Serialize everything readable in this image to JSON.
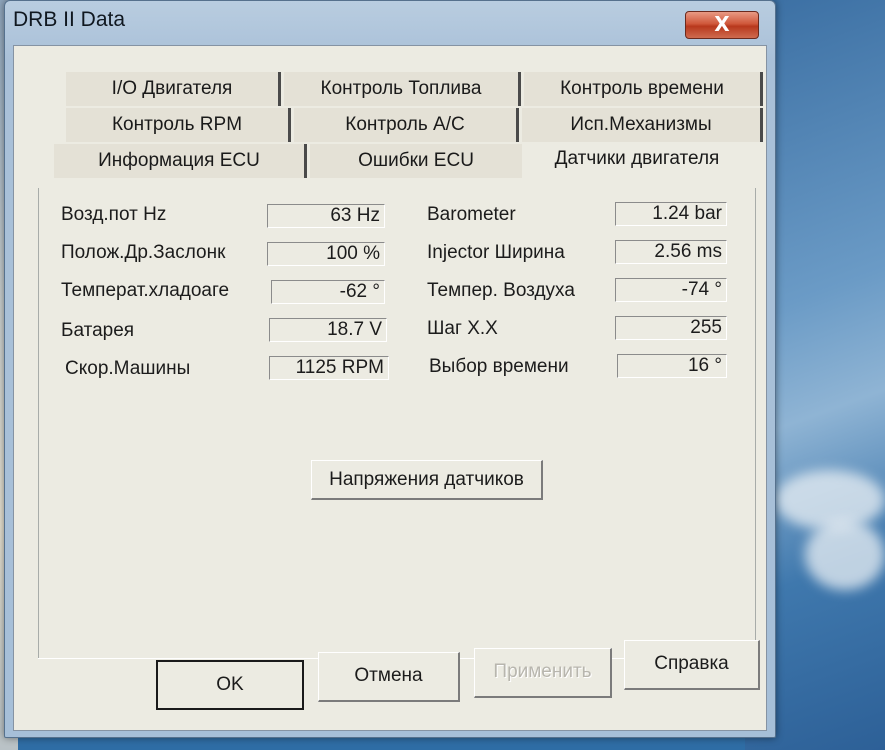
{
  "window": {
    "title": "DRB II Data",
    "close_glyph": "X"
  },
  "tabs": [
    {
      "label": "I/O Двигателя"
    },
    {
      "label": "Контроль Топлива"
    },
    {
      "label": "Контроль времени"
    },
    {
      "label": "Контроль RPM"
    },
    {
      "label": "Контроль A/C"
    },
    {
      "label": "Исп.Механизмы"
    },
    {
      "label": "Информация ECU"
    },
    {
      "label": "Ошибки ECU"
    },
    {
      "label": "Датчики двигателя",
      "active": true
    }
  ],
  "sensors_left": [
    {
      "label": "Возд.пот Hz",
      "value": "63 Hz"
    },
    {
      "label": "Полож.Др.Заслонк",
      "value": "100 %"
    },
    {
      "label": "Температ.хладоаге",
      "value": "-62 °"
    },
    {
      "label": "Батарея",
      "value": "18.7 V"
    },
    {
      "label": "Скор.Машины",
      "value": "1125 RPM"
    }
  ],
  "sensors_right": [
    {
      "label": "Barometer",
      "value": "1.24 bar"
    },
    {
      "label": "Injector Ширина",
      "value": "2.56 ms"
    },
    {
      "label": "Темпер. Воздуха",
      "value": "-74 °"
    },
    {
      "label": "Шаг X.X",
      "value": "255"
    },
    {
      "label": "Выбор времени",
      "value": "16 °"
    }
  ],
  "sensor_voltages_button": "Напряжения датчиков",
  "footer": {
    "ok": "OK",
    "cancel": "Отмена",
    "apply": "Применить",
    "help": "Справка"
  },
  "colors": {
    "dialog_face": "#ecebe2",
    "close_button": "#c9492d",
    "frame": "#a9c0d8"
  }
}
